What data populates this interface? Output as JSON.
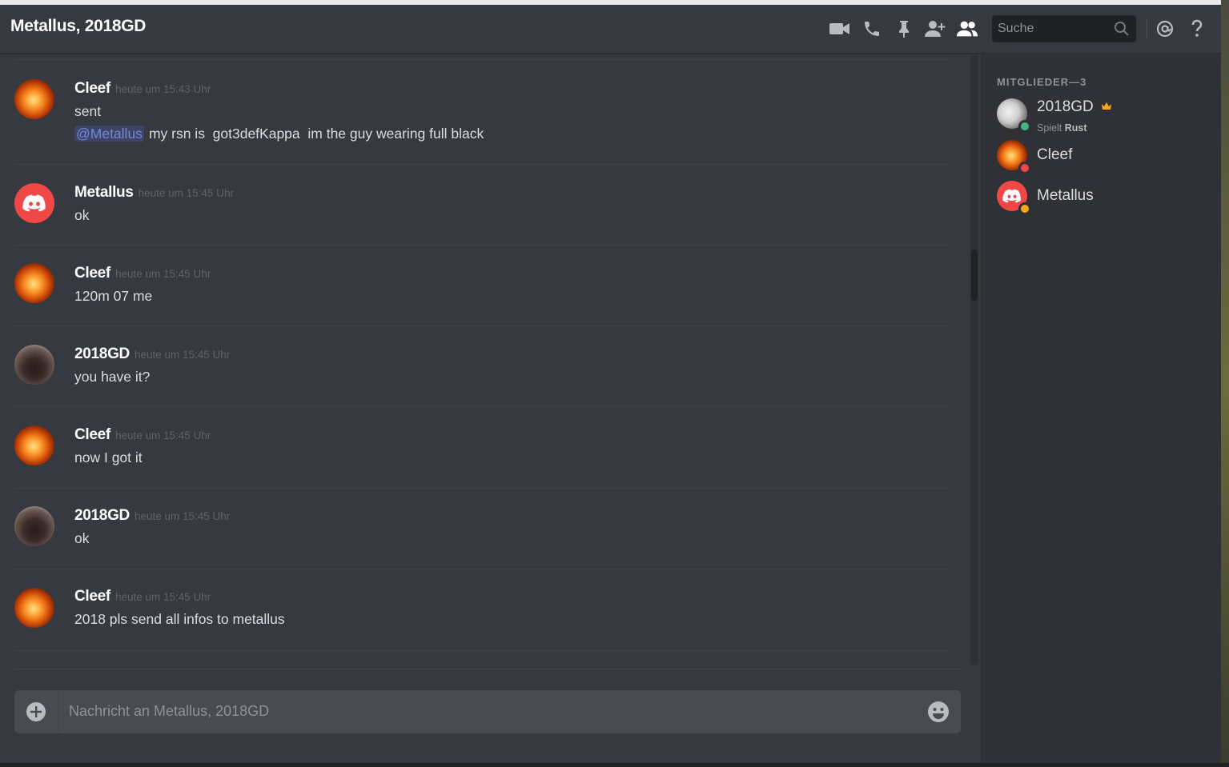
{
  "header": {
    "title": "Metallus, 2018GD",
    "search_placeholder": "Suche",
    "icons": [
      "video-call-icon",
      "voice-call-icon",
      "pin-icon",
      "add-friend-icon",
      "member-list-icon",
      "search-icon",
      "mention-icon",
      "help-icon"
    ]
  },
  "messages": [
    {
      "user": "Cleef",
      "time": "heute um 15:43 Uhr",
      "lines": [
        "sent"
      ],
      "mention": "@Metallus",
      "mention_text": "my rsn is  got3defKappa  im the guy wearing full black"
    },
    {
      "user": "Metallus",
      "time": "heute um 15:45 Uhr",
      "lines": [
        "ok"
      ]
    },
    {
      "user": "Cleef",
      "time": "heute um 15:45 Uhr",
      "lines": [
        "120m 07 me"
      ]
    },
    {
      "user": "2018GD",
      "time": "heute um 15:45 Uhr",
      "lines": [
        "you have it?"
      ]
    },
    {
      "user": "Cleef",
      "time": "heute um 15:45 Uhr",
      "lines": [
        "now I got it"
      ]
    },
    {
      "user": "2018GD",
      "time": "heute um 15:45 Uhr",
      "lines": [
        "ok"
      ]
    },
    {
      "user": "Cleef",
      "time": "heute um 15:45 Uhr",
      "lines": [
        "2018 pls send all infos to metallus"
      ]
    }
  ],
  "input": {
    "placeholder": "Nachricht an Metallus, 2018GD"
  },
  "members": {
    "title": "MITGLIEDER—3",
    "list": [
      {
        "name": "2018GD",
        "activity_prefix": "Spielt",
        "activity": "Rust",
        "status": "online",
        "owner": true
      },
      {
        "name": "Cleef",
        "status": "dnd"
      },
      {
        "name": "Metallus",
        "status": "idle"
      }
    ]
  },
  "colors": {
    "accent": "#7289da",
    "online": "#43b581",
    "dnd": "#f04747",
    "idle": "#faa61a",
    "discord_red": "#f04747"
  }
}
